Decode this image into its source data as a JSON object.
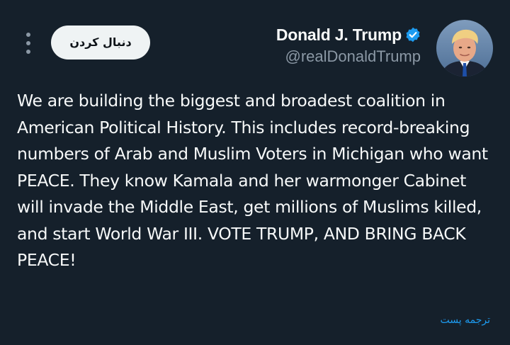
{
  "tweet": {
    "author": {
      "display_name": "Donald J. Trump",
      "handle": "@realDonaldTrump",
      "verified": true,
      "verified_icon": "verified-badge-icon",
      "avatar": "profile-photo"
    },
    "actions": {
      "follow_label": "دنبال کردن",
      "more_icon": "more-vertical-icon"
    },
    "text": "We are building the biggest and broadest coalition in American Political History. This includes record-breaking numbers of Arab and Muslim Voters in Michigan who want PEACE. They know Kamala and her warmonger Cabinet will invade the Middle East, get millions of Muslims killed, and start World War III. VOTE TRUMP, AND BRING BACK PEACE!",
    "translate_label": "ترجمه پست"
  },
  "colors": {
    "background": "#15202b",
    "text": "#f7f9f9",
    "secondary_text": "#8b98a5",
    "accent": "#1d9bf0",
    "follow_button_bg": "#eff3f4"
  }
}
